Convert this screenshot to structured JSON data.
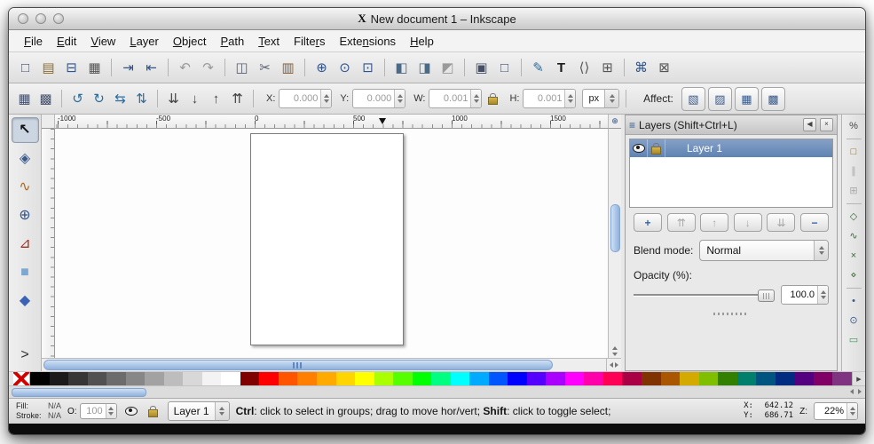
{
  "window": {
    "title": "New document 1 – Inkscape",
    "icon_glyph": "X"
  },
  "menu": {
    "items": [
      {
        "label": "File",
        "underline": 0
      },
      {
        "label": "Edit",
        "underline": 0
      },
      {
        "label": "View",
        "underline": 0
      },
      {
        "label": "Layer",
        "underline": 0
      },
      {
        "label": "Object",
        "underline": 0
      },
      {
        "label": "Path",
        "underline": 0
      },
      {
        "label": "Text",
        "underline": 0
      },
      {
        "label": "Filters",
        "underline": 5
      },
      {
        "label": "Extensions",
        "underline": 4
      },
      {
        "label": "Help",
        "underline": 0
      }
    ]
  },
  "command_bar": {
    "items": [
      {
        "name": "new-document-button",
        "glyph": "□",
        "color": "#44506a"
      },
      {
        "name": "open-document-button",
        "glyph": "▤",
        "color": "#8a6a2a"
      },
      {
        "name": "save-document-button",
        "glyph": "⊟",
        "color": "#30538a"
      },
      {
        "name": "print-document-button",
        "glyph": "▦",
        "color": "#555555"
      },
      {
        "sep": true
      },
      {
        "name": "import-bitmap-button",
        "glyph": "⇥",
        "color": "#30538a"
      },
      {
        "name": "export-bitmap-button",
        "glyph": "⇤",
        "color": "#30538a"
      },
      {
        "sep": true
      },
      {
        "name": "undo-button",
        "glyph": "↶",
        "color": "#9a9a9a",
        "disabled": true
      },
      {
        "name": "redo-button",
        "glyph": "↷",
        "color": "#9a9a9a",
        "disabled": true
      },
      {
        "sep": true
      },
      {
        "name": "copy-button",
        "glyph": "◫",
        "color": "#556070"
      },
      {
        "name": "cut-button",
        "glyph": "✂",
        "color": "#556070"
      },
      {
        "name": "paste-button",
        "glyph": "▥",
        "color": "#8a5a2a"
      },
      {
        "sep": true
      },
      {
        "name": "zoom-to-selection-button",
        "glyph": "⊕",
        "color": "#30538a"
      },
      {
        "name": "zoom-to-drawing-button",
        "glyph": "⊙",
        "color": "#30538a"
      },
      {
        "name": "zoom-to-page-button",
        "glyph": "⊡",
        "color": "#30538a"
      },
      {
        "sep": true
      },
      {
        "name": "duplicate-button",
        "glyph": "◧",
        "color": "#4a6a8a"
      },
      {
        "name": "create-clone-button",
        "glyph": "◨",
        "color": "#4a6a8a"
      },
      {
        "name": "unlink-clone-button",
        "glyph": "◩",
        "color": "#9a9a9a"
      },
      {
        "sep": true
      },
      {
        "name": "group-objects-button",
        "glyph": "▣",
        "color": "#44506a"
      },
      {
        "name": "ungroup-objects-button",
        "glyph": "□",
        "color": "#44506a"
      },
      {
        "sep": true
      },
      {
        "name": "fill-stroke-dialog-button",
        "glyph": "✎",
        "color": "#2e6b9a"
      },
      {
        "name": "text-dialog-button",
        "glyph": "T",
        "color": "#1a1a1a",
        "bold": true
      },
      {
        "name": "xml-editor-button",
        "glyph": "⟨⟩",
        "color": "#555555"
      },
      {
        "name": "align-distribute-dialog-button",
        "glyph": "⊞",
        "color": "#555555"
      },
      {
        "sep": true
      },
      {
        "name": "preferences-button",
        "glyph": "⌘",
        "color": "#30538a"
      },
      {
        "name": "document-properties-button",
        "glyph": "⊠",
        "color": "#555555"
      }
    ]
  },
  "tool_controls": {
    "icons": [
      {
        "name": "select-all-button",
        "glyph": "▦",
        "color": "#44506a"
      },
      {
        "name": "select-all-layers-button",
        "glyph": "▩",
        "color": "#44506a"
      },
      {
        "sep": true
      },
      {
        "name": "rotate-ccw-button",
        "glyph": "↺",
        "color": "#2e6b9a"
      },
      {
        "name": "rotate-cw-button",
        "glyph": "↻",
        "color": "#2e6b9a"
      },
      {
        "name": "flip-horizontal-button",
        "glyph": "⇆",
        "color": "#2e6b9a"
      },
      {
        "name": "flip-vertical-button",
        "glyph": "⇅",
        "color": "#2e6b9a"
      },
      {
        "sep": true
      },
      {
        "name": "lower-to-bottom-button",
        "glyph": "⇊",
        "color": "#444444"
      },
      {
        "name": "lower-button",
        "glyph": "↓",
        "color": "#444444"
      },
      {
        "name": "raise-button",
        "glyph": "↑",
        "color": "#444444"
      },
      {
        "name": "raise-to-top-button",
        "glyph": "⇈",
        "color": "#444444"
      },
      {
        "sep": true
      }
    ],
    "x_label": "X:",
    "x_value": "0.000",
    "y_label": "Y:",
    "y_value": "0.000",
    "w_label": "W:",
    "w_value": "0.001",
    "h_label": "H:",
    "h_value": "0.001",
    "unit_value": "px",
    "affect_label": "Affect:",
    "affect_buttons": [
      {
        "name": "scale-stroke-toggle",
        "glyph": "▧",
        "color": "#3a5a8a"
      },
      {
        "name": "scale-corners-toggle",
        "glyph": "▨",
        "color": "#3a5a8a"
      },
      {
        "name": "move-gradients-toggle",
        "glyph": "▦",
        "color": "#3a5a8a"
      },
      {
        "name": "move-patterns-toggle",
        "glyph": "▩",
        "color": "#3a5a8a"
      }
    ]
  },
  "toolbox": {
    "tools": [
      {
        "name": "selector-tool",
        "glyph": "↖",
        "color": "#111111",
        "active": true,
        "bold": true
      },
      {
        "name": "node-tool",
        "glyph": "◈",
        "color": "#3a5a8a"
      },
      {
        "name": "tweak-tool",
        "glyph": "∿",
        "color": "#b06820"
      },
      {
        "name": "zoom-tool",
        "glyph": "⊕",
        "color": "#30538a"
      },
      {
        "name": "measure-tool",
        "glyph": "⊿",
        "color": "#a03020"
      },
      {
        "name": "rectangle-tool",
        "glyph": "■",
        "color": "#7fa8d0"
      },
      {
        "name": "box3d-tool",
        "glyph": "◆",
        "color": "#3a62b5"
      },
      {
        "name": "toolbox-overflow-button",
        "glyph": ">",
        "color": "#333333",
        "bottom": true
      }
    ]
  },
  "ruler": {
    "ticks": [
      "-1000",
      "-500",
      "0",
      "500",
      "1000",
      "1500"
    ],
    "corner_glyph": "⊕"
  },
  "snap_toolbar": {
    "items": [
      {
        "name": "enable-snapping-toggle",
        "glyph": "%",
        "color": "#444444"
      },
      {
        "sep": true
      },
      {
        "name": "snap-bounding-boxes-toggle",
        "glyph": "□",
        "color": "#8a6a2a"
      },
      {
        "name": "snap-bbox-edges-toggle",
        "glyph": "∥",
        "color": "#aaaaaa",
        "disabled": true
      },
      {
        "name": "snap-bbox-corners-toggle",
        "glyph": "⊞",
        "color": "#aaaaaa",
        "disabled": true
      },
      {
        "sep": true
      },
      {
        "name": "snap-nodes-toggle",
        "glyph": "◇",
        "color": "#3a6a3a"
      },
      {
        "name": "snap-paths-toggle",
        "glyph": "∿",
        "color": "#3a6a3a"
      },
      {
        "name": "snap-path-intersections-toggle",
        "glyph": "×",
        "color": "#3a6a3a"
      },
      {
        "name": "snap-cusp-nodes-toggle",
        "glyph": "⋄",
        "color": "#3a6a3a"
      },
      {
        "sep": true
      },
      {
        "name": "snap-midpoints-toggle",
        "glyph": "•",
        "color": "#3a5a8a"
      },
      {
        "name": "snap-object-centers-toggle",
        "glyph": "⊙",
        "color": "#3a5a8a"
      },
      {
        "name": "snap-page-border-toggle",
        "glyph": "▭",
        "color": "#3a9a5a"
      }
    ]
  },
  "layers_panel": {
    "title": "Layers (Shift+Ctrl+L)",
    "dock_glyph": "◀",
    "close_glyph": "×",
    "title_icon_glyph": "≡",
    "layer_name": "Layer 1",
    "buttons": [
      {
        "name": "new-layer-button",
        "glyph": "+",
        "color": "#3465a4",
        "bold": true
      },
      {
        "name": "raise-layer-to-top-button",
        "glyph": "⇈",
        "color": "#a8a8a8",
        "disabled": true
      },
      {
        "name": "raise-layer-button",
        "glyph": "↑",
        "color": "#a8a8a8",
        "disabled": true
      },
      {
        "name": "lower-layer-button",
        "glyph": "↓",
        "color": "#a8a8a8",
        "disabled": true
      },
      {
        "name": "lower-layer-to-bottom-button",
        "glyph": "⇊",
        "color": "#a8a8a8",
        "disabled": true
      },
      {
        "name": "delete-layer-button",
        "glyph": "−",
        "color": "#3465a4",
        "bold": true
      }
    ],
    "blend_label": "Blend mode:",
    "blend_value": "Normal",
    "opacity_label": "Opacity (%):",
    "opacity_value": "100.0"
  },
  "palette": {
    "more_glyph": "▶",
    "colors": [
      "#000000",
      "#1b1b1b",
      "#363636",
      "#515151",
      "#6c6c6c",
      "#878787",
      "#a2a2a2",
      "#bdbdbd",
      "#d8d8d8",
      "#f3f3f3",
      "#ffffff",
      "#800000",
      "#ff0000",
      "#ff5500",
      "#ff8000",
      "#ffaa00",
      "#ffd500",
      "#ffff00",
      "#aaff00",
      "#55ff00",
      "#00ff00",
      "#00ff80",
      "#00ffff",
      "#00aaff",
      "#0055ff",
      "#0000ff",
      "#5500ff",
      "#aa00ff",
      "#ff00ff",
      "#ff00aa",
      "#ff0055",
      "#aa0044",
      "#803300",
      "#aa5500",
      "#d4aa00",
      "#7fbf00",
      "#338000",
      "#00806c",
      "#005580",
      "#002b80",
      "#550080",
      "#800066",
      "#803380"
    ]
  },
  "status": {
    "fill_label": "Fill:",
    "fill_value": "N/A",
    "stroke_label": "Stroke:",
    "stroke_value": "N/A",
    "opacity_label": "O:",
    "opacity_value": "100",
    "layer_value": "Layer 1",
    "message_parts": [
      {
        "text": "Ctrl",
        "bold": true
      },
      {
        "text": ": click to select in groups; drag to move hor/vert; ",
        "bold": false
      },
      {
        "text": "Shift",
        "bold": true
      },
      {
        "text": ": click to toggle select;",
        "bold": false
      }
    ],
    "x_label": "X:",
    "x_value": "642.12",
    "y_label": "Y:",
    "y_value": "686.71",
    "z_label": "Z:",
    "zoom_value": "22%"
  }
}
